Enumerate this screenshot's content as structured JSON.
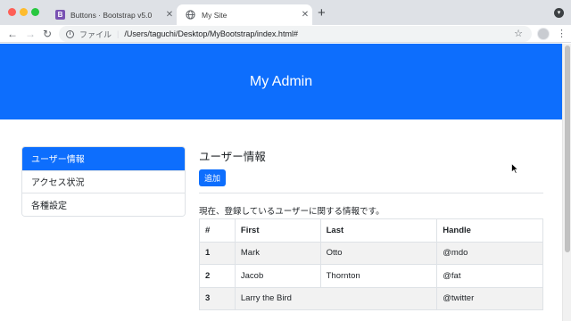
{
  "browser": {
    "tabs": [
      {
        "title": "Buttons · Bootstrap v5.0",
        "favicon": "B",
        "active": false
      },
      {
        "title": "My Site",
        "active": true
      }
    ],
    "new_tab_label": "+",
    "toolbar": {
      "back_label": "←",
      "forward_label": "→",
      "reload_label": "↻",
      "url_scheme": "ファイル",
      "url": "/Users/taguchi/Desktop/MyBootstrap/index.html#",
      "star_label": "☆",
      "menu_label": "⋮"
    }
  },
  "page": {
    "brand_title": "My Admin",
    "sidebar": {
      "items": [
        {
          "label": "ユーザー情報",
          "active": true
        },
        {
          "label": "アクセス状況",
          "active": false
        },
        {
          "label": "各種設定",
          "active": false
        }
      ]
    },
    "main": {
      "title": "ユーザー情報",
      "add_button_label": "追加",
      "description": "現在、登録しているユーザーに関する情報です。"
    },
    "table": {
      "headers": [
        "#",
        "First",
        "Last",
        "Handle"
      ],
      "rows": [
        [
          "1",
          "Mark",
          "Otto",
          "@mdo"
        ],
        [
          "2",
          "Jacob",
          "Thornton",
          "@fat"
        ],
        [
          "3",
          "Larry the Bird",
          "",
          "@twitter"
        ]
      ]
    }
  },
  "colors": {
    "primary": "#0d6efd",
    "tabstrip": "#dee1e6",
    "striped_row": "#f2f2f2",
    "border": "#dee2e6"
  }
}
